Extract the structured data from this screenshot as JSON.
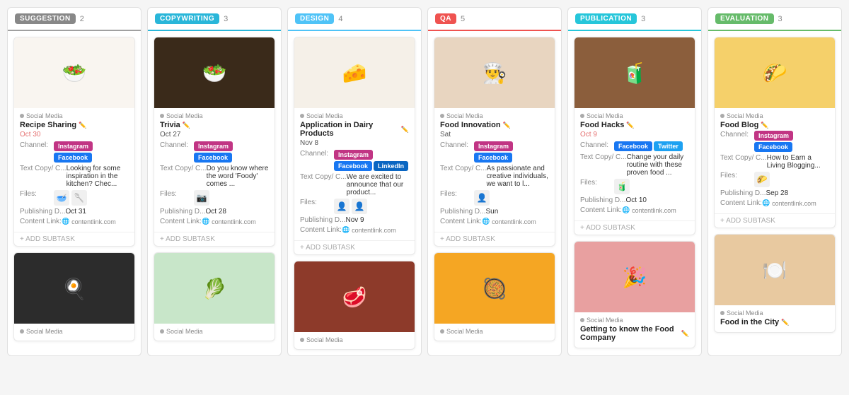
{
  "columns": [
    {
      "id": "suggestion",
      "badge_label": "SUGGESTION",
      "badge_color": "#888888",
      "header_border": "#a0a0a0",
      "count": "2",
      "cards": [
        {
          "image_emoji": "🥗",
          "image_bg": "#f9f5f0",
          "category": "Social Media",
          "title": "Recipe Sharing",
          "date": "Oct 30",
          "date_red": true,
          "channel_label": "Channel:",
          "channels": [
            "Instagram",
            "Facebook"
          ],
          "text_label": "Text Copy/ C...",
          "text_value": "Looking for some inspiration in the kitchen? Chec...",
          "files_label": "Files:",
          "files": [
            "🥣",
            "🥄"
          ],
          "pub_label": "Publishing D...",
          "pub_value": "Oct 31",
          "link_label": "Content Link:",
          "link_value": "contentlink.com",
          "add_subtask": "+ ADD SUBTASK"
        },
        {
          "image_emoji": "🍳",
          "image_bg": "#2c2c2c",
          "category": "Social Media",
          "title": "...",
          "date": "",
          "date_red": false,
          "channel_label": "",
          "channels": [],
          "text_label": "",
          "text_value": "",
          "files_label": "",
          "files": [],
          "pub_label": "",
          "pub_value": "",
          "link_label": "",
          "link_value": "",
          "add_subtask": ""
        }
      ]
    },
    {
      "id": "copywriting",
      "badge_label": "COPYWRITING",
      "badge_color": "#29b6d9",
      "header_border": "#29b6d9",
      "count": "3",
      "cards": [
        {
          "image_emoji": "🥗",
          "image_bg": "#3a2a1a",
          "category": "Social Media",
          "title": "Trivia",
          "date": "Oct 27",
          "date_red": false,
          "channel_label": "Channel:",
          "channels": [
            "Instagram",
            "Facebook"
          ],
          "text_label": "Text Copy/ C...",
          "text_value": "Do you know where the word 'Foody' comes ...",
          "files_label": "Files:",
          "files": [
            "📷"
          ],
          "pub_label": "Publishing D...",
          "pub_value": "Oct 28",
          "link_label": "Content Link:",
          "link_value": "contentlink.com",
          "add_subtask": "+ ADD SUBTASK"
        },
        {
          "image_emoji": "🥬",
          "image_bg": "#c8e6c9",
          "category": "Social Media",
          "title": "...",
          "date": "",
          "date_red": false,
          "channel_label": "",
          "channels": [],
          "text_label": "",
          "text_value": "",
          "files_label": "",
          "files": [],
          "pub_label": "",
          "pub_value": "",
          "link_label": "",
          "link_value": "",
          "add_subtask": ""
        }
      ]
    },
    {
      "id": "design",
      "badge_label": "DESIGN",
      "badge_color": "#4fc3f7",
      "header_border": "#4fc3f7",
      "count": "4",
      "cards": [
        {
          "image_emoji": "🧀",
          "image_bg": "#f5f0e8",
          "category": "Social Media",
          "title": "Application in Dairy Products",
          "date": "Nov 8",
          "date_red": false,
          "channel_label": "Channel:",
          "channels": [
            "Instagram",
            "Facebook",
            "LinkedIn"
          ],
          "text_label": "Text Copy/ C...",
          "text_value": "We are excited to announce that our product...",
          "files_label": "Files:",
          "files": [
            "👤",
            "👤"
          ],
          "pub_label": "Publishing D...",
          "pub_value": "Nov 9",
          "link_label": "Content Link:",
          "link_value": "contentlink.com",
          "add_subtask": "+ ADD SUBTASK"
        },
        {
          "image_emoji": "🥩",
          "image_bg": "#8d3a2a",
          "category": "Social Media",
          "title": "...",
          "date": "",
          "date_red": false,
          "channel_label": "",
          "channels": [],
          "text_label": "",
          "text_value": "",
          "files_label": "",
          "files": [],
          "pub_label": "",
          "pub_value": "",
          "link_label": "",
          "link_value": "",
          "add_subtask": ""
        }
      ]
    },
    {
      "id": "qa",
      "badge_label": "QA",
      "badge_color": "#ef5350",
      "header_border": "#ef5350",
      "count": "5",
      "cards": [
        {
          "image_emoji": "👨‍🍳",
          "image_bg": "#e8d5c0",
          "category": "Social Media",
          "title": "Food Innovation",
          "date": "Sat",
          "date_red": false,
          "channel_label": "Channel:",
          "channels": [
            "Instagram",
            "Facebook"
          ],
          "text_label": "Text Copy/ C...",
          "text_value": "As passionate and creative individuals, we want to l...",
          "files_label": "Files:",
          "files": [
            "👤"
          ],
          "pub_label": "Publishing D...",
          "pub_value": "Sun",
          "link_label": "Content Link:",
          "link_value": "contentlink.com",
          "add_subtask": "+ ADD SUBTASK"
        },
        {
          "image_emoji": "🥘",
          "image_bg": "#f5a623",
          "category": "Social Media",
          "title": "...",
          "date": "",
          "date_red": false,
          "channel_label": "",
          "channels": [],
          "text_label": "",
          "text_value": "",
          "files_label": "",
          "files": [],
          "pub_label": "",
          "pub_value": "",
          "link_label": "",
          "link_value": "",
          "add_subtask": ""
        }
      ]
    },
    {
      "id": "publication",
      "badge_label": "PUBLICATION",
      "badge_color": "#26c6da",
      "header_border": "#26c6da",
      "count": "3",
      "cards": [
        {
          "image_emoji": "🧃",
          "image_bg": "#8B5E3C",
          "category": "Social Media",
          "title": "Food Hacks",
          "date": "Oct 9",
          "date_red": true,
          "channel_label": "Channel:",
          "channels": [
            "Facebook",
            "Twitter"
          ],
          "text_label": "Text Copy/ C...",
          "text_value": "Change your daily routine with these proven food ...",
          "files_label": "Files:",
          "files": [
            "🧃"
          ],
          "pub_label": "Publishing D...",
          "pub_value": "Oct 10",
          "link_label": "Content Link:",
          "link_value": "contentlink.com",
          "add_subtask": "+ ADD SUBTASK"
        },
        {
          "image_emoji": "🎉",
          "image_bg": "#e8a0a0",
          "category": "Social Media",
          "title": "Getting to know the Food Company",
          "date": "",
          "date_red": false,
          "channel_label": "",
          "channels": [],
          "text_label": "",
          "text_value": "",
          "files_label": "",
          "files": [],
          "pub_label": "",
          "pub_value": "",
          "link_label": "",
          "link_value": "",
          "add_subtask": ""
        }
      ]
    },
    {
      "id": "evaluation",
      "badge_label": "EVALUATION",
      "badge_color": "#66bb6a",
      "header_border": "#66bb6a",
      "count": "3",
      "cards": [
        {
          "image_emoji": "🌮",
          "image_bg": "#f5d06a",
          "category": "Social Media",
          "title": "Food Blog",
          "date": "",
          "date_red": false,
          "channel_label": "Channel:",
          "channels": [
            "Instagram",
            "Facebook"
          ],
          "text_label": "Text Copy/ C...",
          "text_value": "How to Earn a Living Blogging...",
          "files_label": "Files:",
          "files": [
            "🌮"
          ],
          "pub_label": "Publishing D...",
          "pub_value": "Sep 28",
          "link_label": "Content Link:",
          "link_value": "contentlink.com",
          "add_subtask": "+ ADD SUBTASK"
        },
        {
          "image_emoji": "🍽️",
          "image_bg": "#e8c9a0",
          "category": "Social Media",
          "title": "Food in the City",
          "date": "",
          "date_red": false,
          "channel_label": "",
          "channels": [],
          "text_label": "",
          "text_value": "",
          "files_label": "",
          "files": [],
          "pub_label": "",
          "pub_value": "",
          "link_label": "",
          "link_value": "",
          "add_subtask": ""
        }
      ]
    }
  ],
  "channel_colors": {
    "Instagram": "tag-instagram",
    "Facebook": "tag-facebook",
    "LinkedIn": "tag-linkedin",
    "Twitter": "tag-twitter"
  }
}
